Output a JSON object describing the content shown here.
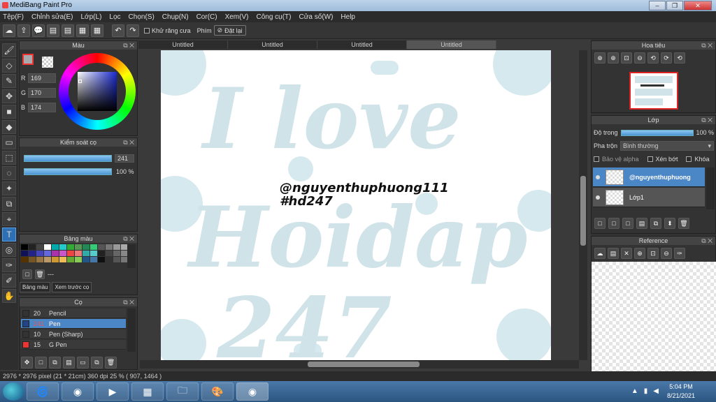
{
  "window": {
    "title": "MediBang Paint Pro",
    "min": "–",
    "max": "❐",
    "close": "✕"
  },
  "menu": [
    "Tệp(F)",
    "Chỉnh sửa(E)",
    "Lớp(L)",
    "Lọc",
    "Chọn(S)",
    "Chụp(N)",
    "Cor(C)",
    "Xem(V)",
    "Công cụ(T)",
    "Cửa số(W)",
    "Help"
  ],
  "toolbar": {
    "antialias_label": "Khử răng cưa",
    "key_label": "Phím",
    "reset_label": "Đặt lại",
    "icons": [
      "☁",
      "⇪",
      "💬",
      "▤",
      "▤",
      "▦",
      "▦"
    ],
    "undo": "↶",
    "redo": "↷",
    "reset_icon": "⊘"
  },
  "tools": [
    "🖌",
    "◇",
    "✎",
    "✥",
    "■",
    "◆",
    "▭",
    "⬚",
    "◌",
    "✦",
    "⧉",
    "⌖",
    "T",
    "◎",
    "✑",
    "✐",
    "✋"
  ],
  "panel_ctl": "⧉ ✕",
  "color": {
    "title": "Màu",
    "r_label": "R",
    "g_label": "G",
    "b_label": "B",
    "r": "169",
    "g": "170",
    "b": "174",
    "current": "#a9aaae"
  },
  "brush_control": {
    "title": "Kiểm soát cọ",
    "size": "241",
    "opacity": "100 %"
  },
  "palette": {
    "title": "Bảng màu",
    "swatches": [
      "#000",
      "#222",
      "#444",
      "#fff",
      "#0aa",
      "#2cc",
      "#3a3",
      "#595",
      "#285",
      "#3c7",
      "#555",
      "#777",
      "#999",
      "#aaa",
      "#115",
      "#228",
      "#44b",
      "#66d",
      "#a3a",
      "#c5c",
      "#e44",
      "#e77",
      "#3aa",
      "#5cc",
      "#222",
      "#444",
      "#666",
      "#888",
      "#530",
      "#752",
      "#974",
      "#b96",
      "#c93",
      "#eb5",
      "#6a3",
      "#8c5",
      "#258",
      "#47a",
      "#111",
      "#333",
      "#555",
      "#777"
    ],
    "add": "□",
    "delete": "🗑",
    "dash": "---",
    "tab_palette": "Bảng màu",
    "tab_preview": "Xem trước cọ"
  },
  "brush": {
    "title": "Cọ",
    "items": [
      {
        "size": "20",
        "name": "Pencil",
        "color": "#333"
      },
      {
        "size": "241",
        "name": "Pen",
        "color": "#248"
      },
      {
        "size": "10",
        "name": "Pen (Sharp)",
        "color": "#333"
      },
      {
        "size": "15",
        "name": "G Pen",
        "color": "#e33"
      }
    ],
    "tool_icons": [
      "✥",
      "□",
      "⧉",
      "▤",
      "▭",
      "⧉",
      "🗑"
    ]
  },
  "tabs": [
    "Untitled",
    "Untitled",
    "Untitled",
    "Untitled"
  ],
  "canvas_text": {
    "user": "@nguyenthuphuong111",
    "tag": "#hd247",
    "bg_line1": "I love",
    "bg_line2": "Hoidap",
    "bg_line3": "247"
  },
  "navigator": {
    "title": "Hoa tiêu",
    "tool_icons": [
      "⊕",
      "⊕",
      "⊡",
      "⊖",
      "⟲",
      "⟳",
      "⟲"
    ]
  },
  "layer": {
    "title": "Lớp",
    "opacity_label": "Độ trong",
    "opacity_value": "100 %",
    "blend_label": "Pha trộn",
    "blend_mode": "Bình thường",
    "blend_arrow": "▾",
    "protect_alpha": "Bảo vệ alpha",
    "clipping": "Xén bớt",
    "lock": "Khóa",
    "items": [
      "@nguyenthuphuong",
      "Lớp1"
    ],
    "tool_icons": [
      "□",
      "□",
      "□",
      "▤",
      "⧉",
      "⬍",
      "🗑"
    ]
  },
  "reference": {
    "title": "Reference",
    "tool_icons": [
      "☁",
      "▤",
      "✕",
      "⊕",
      "⊡",
      "⊖",
      "✑"
    ]
  },
  "status": "2976 * 2976 pixel  (21 * 21cm)  360 dpi  25 %  ( 907, 1464 )",
  "taskbar": {
    "apps": [
      "🌀",
      "◉",
      "▶",
      "▦",
      "🗀",
      "🎨",
      "◉"
    ],
    "tray_icons": [
      "▲",
      "▮",
      "◀"
    ],
    "time": "5:04 PM",
    "date": "8/21/2021"
  }
}
